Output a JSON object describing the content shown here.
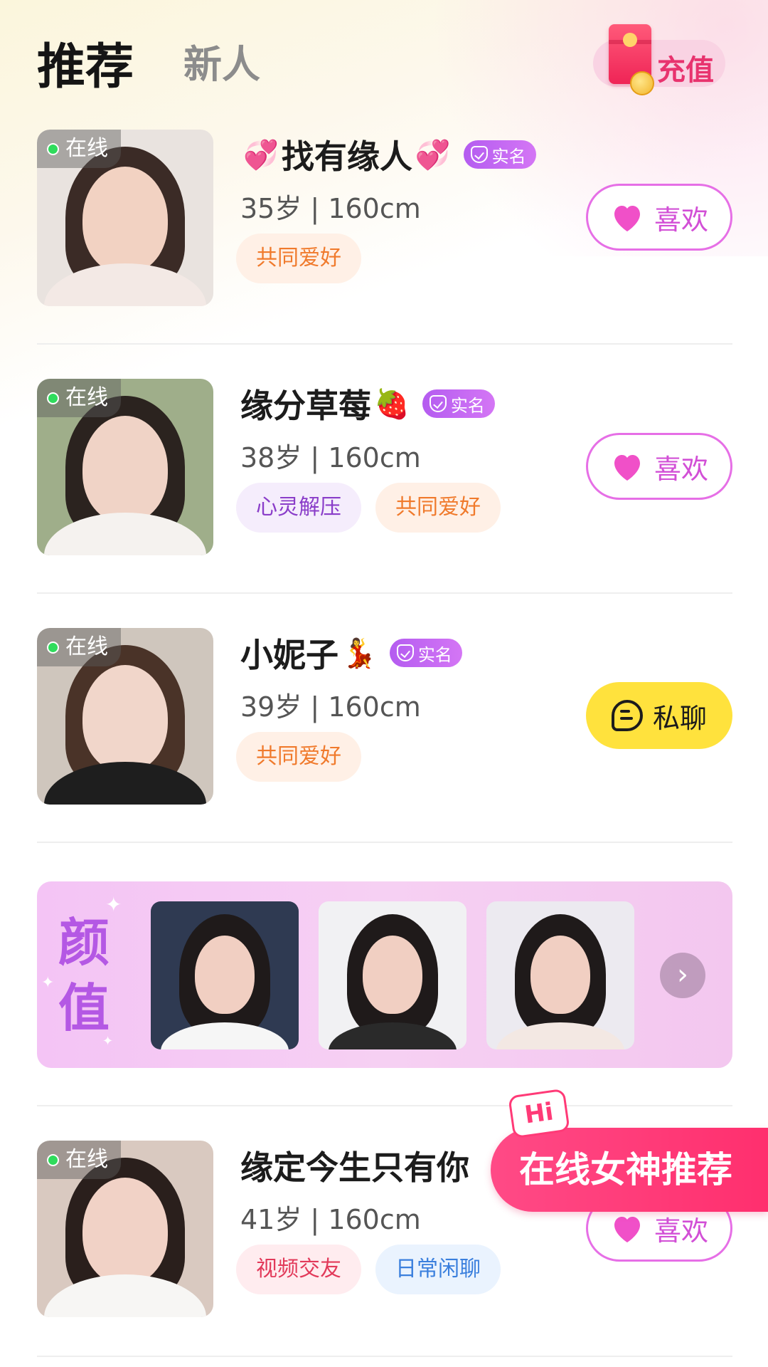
{
  "header": {
    "tab_recommend": "推荐",
    "tab_new": "新人",
    "recharge_label": "充值"
  },
  "profiles": [
    {
      "online_label": "在线",
      "name": "找有缘人",
      "name_prefix_emoji": "💞",
      "name_suffix_emoji": "💞",
      "verified_label": "实名",
      "info": "35岁 | 160cm",
      "tags": [
        "共同爱好"
      ],
      "action_label": "喜欢",
      "action_type": "like"
    },
    {
      "online_label": "在线",
      "name": "缘分草莓",
      "name_suffix_emoji": "🍓",
      "verified_label": "实名",
      "info": "38岁 | 160cm",
      "tags": [
        "心灵解压",
        "共同爱好"
      ],
      "action_label": "喜欢",
      "action_type": "like"
    },
    {
      "online_label": "在线",
      "name": "小妮子",
      "name_suffix_emoji": "💃",
      "verified_label": "实名",
      "info": "39岁 | 160cm",
      "tags": [
        "共同爱好"
      ],
      "action_label": "私聊",
      "action_type": "chat"
    },
    {
      "online_label": "在线",
      "name": "缘定今生只有你",
      "info": "41岁 | 160cm",
      "tags": [
        "视频交友",
        "日常闲聊"
      ],
      "action_label": "喜欢",
      "action_type": "like"
    }
  ],
  "banner": {
    "title_line1": "颜",
    "title_line2": "值",
    "next_icon": "chevron-right-icon"
  },
  "promo": {
    "hi": "Hi",
    "label": "在线女神推荐"
  },
  "colors": {
    "accent_pink": "#e8336e",
    "like_border": "#e66fe6",
    "chat_yellow": "#ffe23d",
    "verified_purple": "#b45cf0",
    "online_green": "#2fdc5c"
  }
}
